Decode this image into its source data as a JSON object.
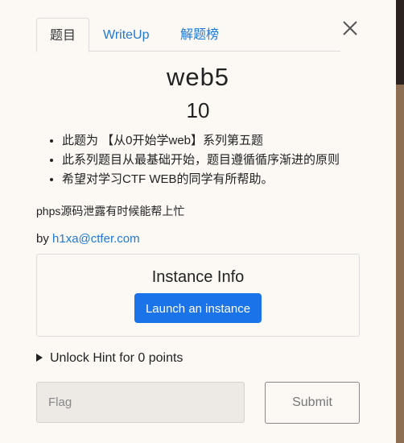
{
  "tabs": [
    {
      "label": "题目",
      "active": true
    },
    {
      "label": "WriteUp",
      "active": false
    },
    {
      "label": "解题榜",
      "active": false
    }
  ],
  "challenge": {
    "name": "web5",
    "points": "10",
    "description": [
      "此题为 【从0开始学web】系列第五题",
      "此系列题目从最基础开始，题目遵循循序渐进的原则",
      "希望对学习CTF WEB的同学有所帮助。"
    ],
    "note": "phps源码泄露有时候能帮上忙",
    "author_prefix": "by ",
    "author": "h1xa@ctfer.com"
  },
  "instance": {
    "title": "Instance Info",
    "launch_label": "Launch an instance"
  },
  "hint": {
    "label": "Unlock Hint for 0 points"
  },
  "flag": {
    "placeholder": "Flag",
    "value": ""
  },
  "submit_label": "Submit",
  "colors": {
    "accent": "#1a73e8",
    "link": "#1e78d8",
    "background": "#fcf9f5"
  }
}
